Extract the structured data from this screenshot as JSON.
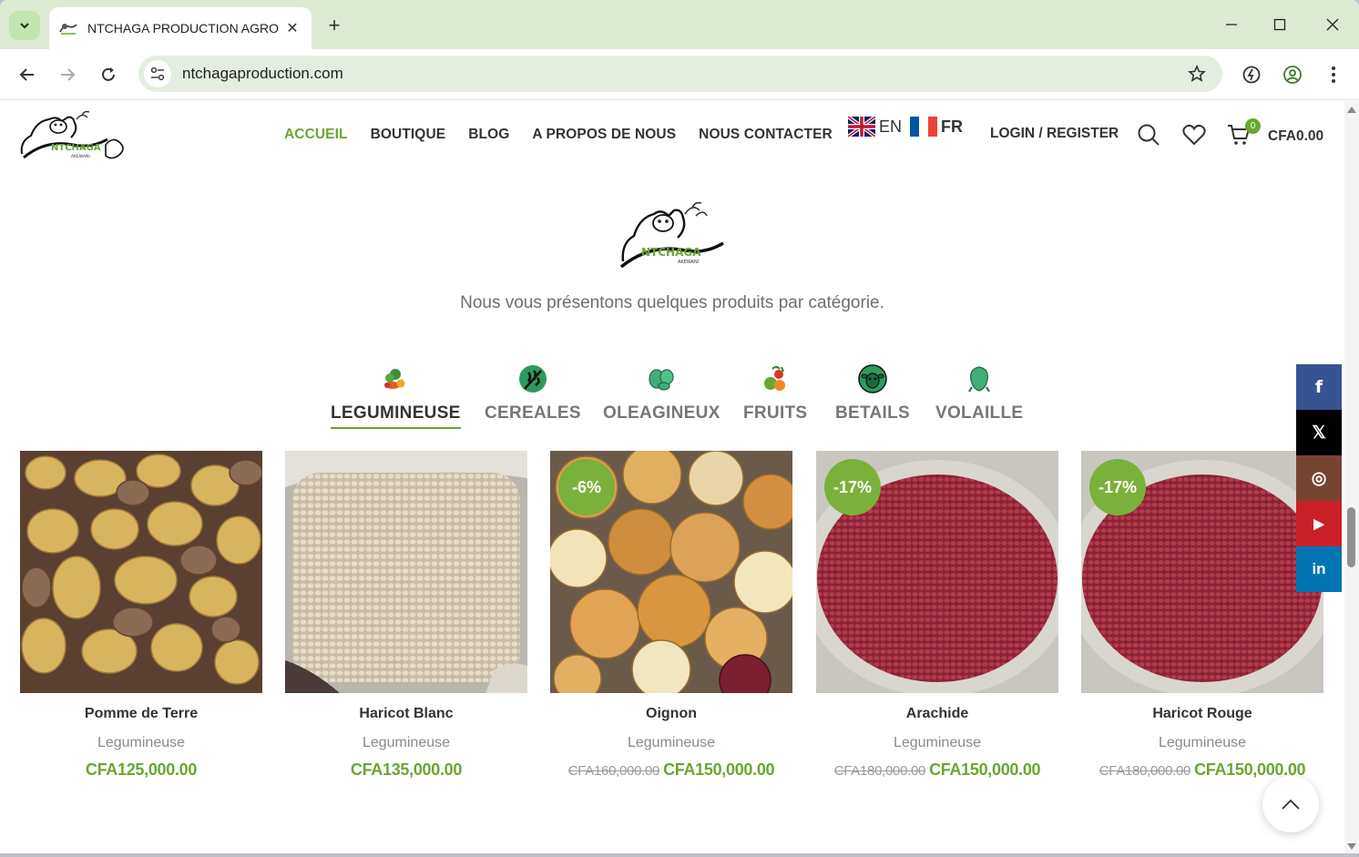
{
  "browser": {
    "tab_title": "NTCHAGA PRODUCTION AGRO",
    "url": "ntchagaproduction.com"
  },
  "header": {
    "logo_text": "NTCHAGA",
    "logo_subtext": "AKEWANI",
    "nav": [
      {
        "label": "ACCUEIL",
        "active": true
      },
      {
        "label": "BOUTIQUE"
      },
      {
        "label": "BLOG"
      },
      {
        "label": "A PROPOS DE NOUS"
      },
      {
        "label": "NOUS CONTACTER"
      }
    ],
    "languages": [
      "EN",
      "FR"
    ],
    "login_label": "LOGIN / REGISTER",
    "cart_count": "0",
    "cart_total": "CFA0.00"
  },
  "intro": {
    "tagline": "Nous vous présentons quelques produits par catégorie."
  },
  "categories": [
    {
      "label": "LEGUMINEUSE",
      "icon": "vegetables-icon",
      "active": true
    },
    {
      "label": "CEREALES",
      "icon": "grain-icon"
    },
    {
      "label": "OLEAGINEUX",
      "icon": "seeds-icon"
    },
    {
      "label": "FRUITS",
      "icon": "fruits-icon"
    },
    {
      "label": "BETAILS",
      "icon": "sheep-icon"
    },
    {
      "label": "VOLAILLE",
      "icon": "chicken-icon"
    }
  ],
  "products": [
    {
      "name": "Pomme de Terre",
      "category": "Legumineuse",
      "price": "CFA125,000.00",
      "old_price": "",
      "badge": ""
    },
    {
      "name": "Haricot Blanc",
      "category": "Legumineuse",
      "price": "CFA135,000.00",
      "old_price": "",
      "badge": ""
    },
    {
      "name": "Oignon",
      "category": "Legumineuse",
      "price": "CFA150,000.00",
      "old_price": "CFA160,000.00",
      "badge": "-6%"
    },
    {
      "name": "Arachide",
      "category": "Legumineuse",
      "price": "CFA150,000.00",
      "old_price": "CFA180,000.00",
      "badge": "-17%"
    },
    {
      "name": "Haricot Rouge",
      "category": "Legumineuse",
      "price": "CFA150,000.00",
      "old_price": "CFA180,000.00",
      "badge": "-17%"
    }
  ],
  "social": [
    {
      "name": "facebook-icon",
      "glyph": "f",
      "color": "#365493"
    },
    {
      "name": "x-icon",
      "glyph": "𝕏",
      "color": "#000000"
    },
    {
      "name": "instagram-icon",
      "glyph": "◎",
      "color": "#774430"
    },
    {
      "name": "youtube-icon",
      "glyph": "▶",
      "color": "#cb2027"
    },
    {
      "name": "linkedin-icon",
      "glyph": "in",
      "color": "#0274b3"
    }
  ],
  "colors": {
    "accent": "#6aa631",
    "badge": "#7ab13a",
    "chrome": "#dcead3"
  }
}
